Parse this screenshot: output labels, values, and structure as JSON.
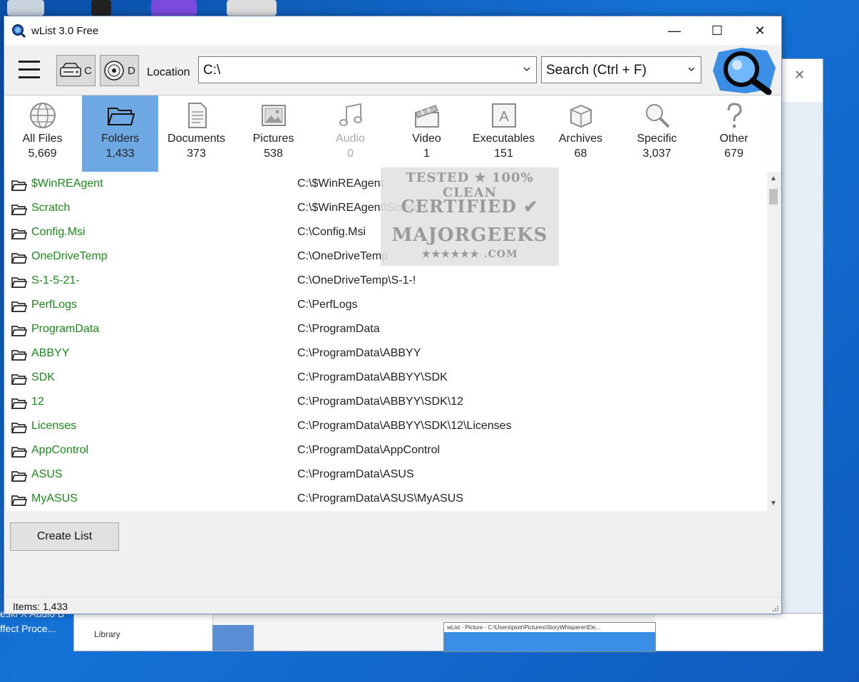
{
  "window": {
    "title": "wList 3.0 Free",
    "controls": {
      "minimize": "—",
      "maximize": "☐",
      "close": "✕"
    }
  },
  "toolbar": {
    "drives": [
      {
        "label": "C",
        "icon": "hard-drive-icon"
      },
      {
        "label": "D",
        "icon": "disc-drive-icon"
      }
    ],
    "location_label": "Location",
    "location_value": "C:\\",
    "search_value": "Search (Ctrl + F)"
  },
  "categories": [
    {
      "label": "All Files",
      "count": "5,669",
      "icon": "globe-icon"
    },
    {
      "label": "Folders",
      "count": "1,433",
      "icon": "folder-icon",
      "selected": true
    },
    {
      "label": "Documents",
      "count": "373",
      "icon": "document-icon"
    },
    {
      "label": "Pictures",
      "count": "538",
      "icon": "picture-icon"
    },
    {
      "label": "Audio",
      "count": "0",
      "icon": "music-note-icon",
      "disabled": true
    },
    {
      "label": "Video",
      "count": "1",
      "icon": "clapperboard-icon"
    },
    {
      "label": "Executables",
      "count": "151",
      "icon": "executable-icon"
    },
    {
      "label": "Archives",
      "count": "68",
      "icon": "archive-box-icon"
    },
    {
      "label": "Specific",
      "count": "3,037",
      "icon": "magnifier-icon"
    },
    {
      "label": "Other",
      "count": "679",
      "icon": "question-mark-icon"
    }
  ],
  "rows": [
    {
      "name": "$WinREAgent",
      "path": "C:\\$WinREAgent"
    },
    {
      "name": "Scratch",
      "path": "C:\\$WinREAgent\\Scratch"
    },
    {
      "name": "Config.Msi",
      "path": "C:\\Config.Msi"
    },
    {
      "name": "OneDriveTemp",
      "path": "C:\\OneDriveTemp"
    },
    {
      "name": "S-1-5-21-",
      "path": "C:\\OneDriveTemp\\S-1-!"
    },
    {
      "name": "PerfLogs",
      "path": "C:\\PerfLogs"
    },
    {
      "name": "ProgramData",
      "path": "C:\\ProgramData"
    },
    {
      "name": "ABBYY",
      "path": "C:\\ProgramData\\ABBYY"
    },
    {
      "name": "SDK",
      "path": "C:\\ProgramData\\ABBYY\\SDK"
    },
    {
      "name": "12",
      "path": "C:\\ProgramData\\ABBYY\\SDK\\12"
    },
    {
      "name": "Licenses",
      "path": "C:\\ProgramData\\ABBYY\\SDK\\12\\Licenses"
    },
    {
      "name": "AppControl",
      "path": "C:\\ProgramData\\AppControl"
    },
    {
      "name": "ASUS",
      "path": "C:\\ProgramData\\ASUS"
    },
    {
      "name": "MyASUS",
      "path": "C:\\ProgramData\\ASUS\\MyASUS"
    }
  ],
  "actions": {
    "create_list": "Create List"
  },
  "status": {
    "items": "Items: 1,433"
  },
  "watermark": {
    "line1": "TESTED ★ 100% CLEAN",
    "line2": "CERTIFIED ✔",
    "line3": "MAJORGEEKS",
    "line4": "★★★★★★ .COM"
  },
  "background": {
    "desktop_labels": [
      "eskl X Audio B",
      "ffect Proce..."
    ],
    "library_label": "Library",
    "preview_caption": "wList - Picture - C:\\Users\\piotr\\Pictures\\StoryWhisperer\\Ele..."
  },
  "colors": {
    "selected_category": "#6ea8e2",
    "folder_name": "#1a8a1a",
    "desktop": "#1572d6"
  }
}
